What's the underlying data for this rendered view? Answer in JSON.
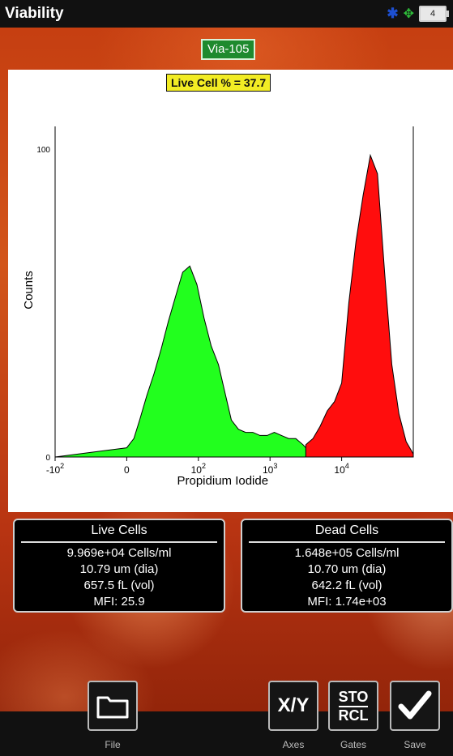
{
  "status_bar": {
    "title": "Viability",
    "icons": [
      "bluetooth-icon",
      "usb-icon",
      "battery-icon"
    ],
    "battery_label": "4"
  },
  "sample_badge": "Via-105",
  "live_cell_percent_label": "Live Cell % = 37.7",
  "chart_data": {
    "type": "area",
    "xlabel": "Propidium Iodide",
    "ylabel": "Counts",
    "ylim": [
      0,
      100
    ],
    "y_ticks": [
      "0",
      "100"
    ],
    "x_ticks": [
      {
        "base": "-10",
        "exp": "2"
      },
      {
        "base": "0",
        "exp": ""
      },
      {
        "base": "10",
        "exp": "2"
      },
      {
        "base": "10",
        "exp": "3"
      },
      {
        "base": "10",
        "exp": "4"
      }
    ],
    "x_scale": "biexponential",
    "series": [
      {
        "color": "#22ff1e",
        "x": [
          -1,
          0.0,
          0.1,
          0.18,
          0.28,
          0.38,
          0.48,
          0.58,
          0.68,
          0.78,
          0.88,
          0.98,
          1.08,
          1.18,
          1.28,
          1.38,
          1.46,
          1.56,
          1.66,
          1.76,
          1.86,
          1.96,
          2.06,
          2.16,
          2.26,
          2.36,
          2.46,
          2.5
        ],
        "y": [
          0,
          3,
          6,
          12,
          20,
          27,
          35,
          44,
          52,
          60,
          62,
          56,
          45,
          36,
          30,
          20,
          12,
          9,
          8,
          8,
          7,
          7,
          8,
          7,
          6,
          6,
          4,
          3
        ]
      },
      {
        "color": "#ff0d0d",
        "x": [
          2.5,
          2.6,
          2.7,
          2.8,
          2.9,
          3.0,
          3.1,
          3.2,
          3.3,
          3.4,
          3.5,
          3.6,
          3.7,
          3.8,
          3.9,
          4.0
        ],
        "y": [
          4,
          6,
          10,
          15,
          18,
          24,
          50,
          70,
          85,
          98,
          92,
          60,
          30,
          14,
          5,
          1
        ]
      }
    ]
  },
  "live_cells": {
    "title": "Live Cells",
    "concentration": "9.969e+04 Cells/ml",
    "diameter": "10.79 um (dia)",
    "volume": "657.5 fL (vol)",
    "mfi": "MFI:  25.9"
  },
  "dead_cells": {
    "title": "Dead Cells",
    "concentration": "1.648e+05 Cells/ml",
    "diameter": "10.70 um (dia)",
    "volume": "642.2 fL (vol)",
    "mfi": "MFI:  1.74e+03"
  },
  "toolbar": {
    "file_label": "File",
    "axes_glyph": "X/Y",
    "axes_label": "Axes",
    "gates_top": "STO",
    "gates_bottom": "RCL",
    "gates_label": "Gates",
    "save_label": "Save"
  }
}
